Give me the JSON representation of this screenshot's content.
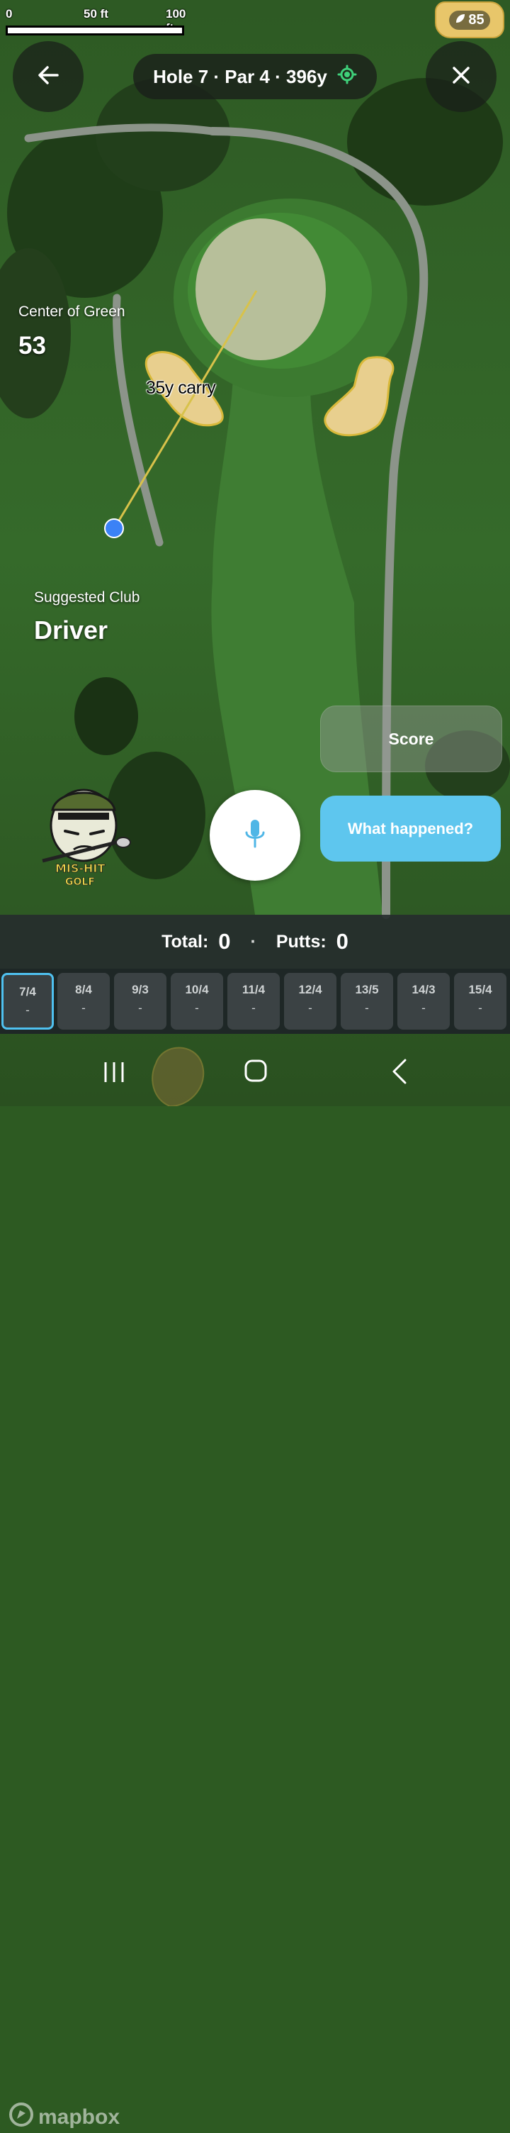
{
  "scale": {
    "label_zero": "0",
    "label_mid": "50 ft",
    "label_end": "100 ft"
  },
  "status": {
    "badge_value": "85"
  },
  "header": {
    "hole_info": "Hole 7 · Par 4 · 396y"
  },
  "map": {
    "target_label": "Center of Green",
    "target_distance": "53",
    "carry_label": "35y carry",
    "suggested_club_label": "Suggested Club",
    "suggested_club": "Driver",
    "attribution": "mapbox",
    "logo_text": "MIS-HIT GOLF"
  },
  "actions": {
    "score_label": "Score",
    "what_happened_label": "What happened?"
  },
  "totals": {
    "total_label": "Total:",
    "total_value": "0",
    "separator": "·",
    "putts_label": "Putts:",
    "putts_value": "0"
  },
  "holes": [
    {
      "label": "7/4",
      "score": "-"
    },
    {
      "label": "8/4",
      "score": "-"
    },
    {
      "label": "9/3",
      "score": "-"
    },
    {
      "label": "10/4",
      "score": "-"
    },
    {
      "label": "11/4",
      "score": "-"
    },
    {
      "label": "12/4",
      "score": "-"
    },
    {
      "label": "13/5",
      "score": "-"
    },
    {
      "label": "14/3",
      "score": "-"
    },
    {
      "label": "15/4",
      "score": "-"
    }
  ],
  "colors": {
    "accent": "#5ec6ee",
    "active_hole_border": "#4fc1f0",
    "gps_icon": "#3fd07a",
    "bunker": "#e8cf8e",
    "aim_line": "#d8c24a",
    "player_dot": "#3b82f6"
  }
}
